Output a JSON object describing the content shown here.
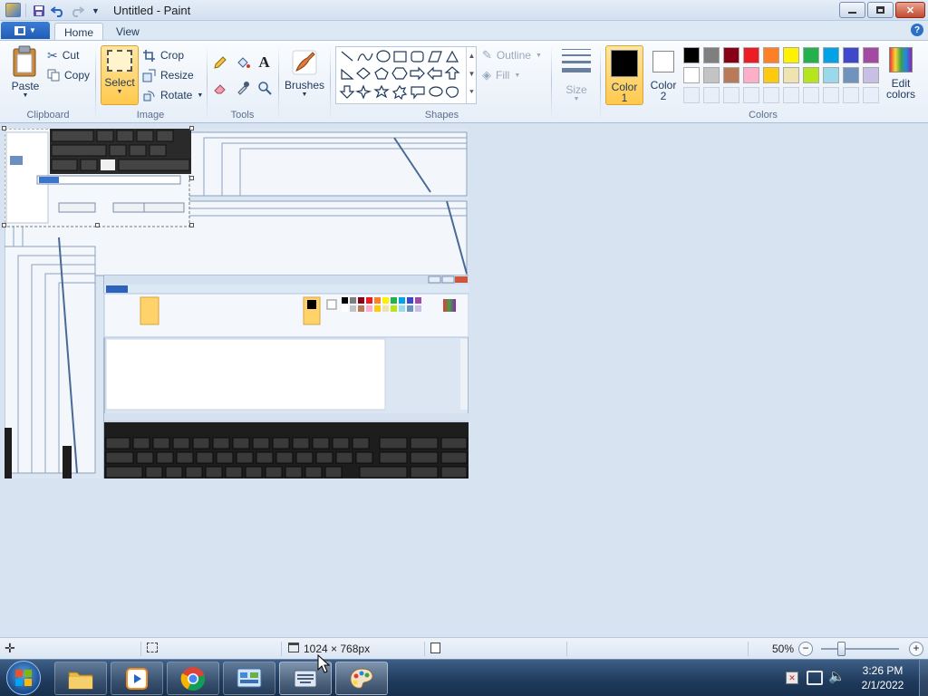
{
  "window": {
    "title": "Untitled - Paint"
  },
  "tabs": {
    "file_icon": "menu-icon",
    "home": "Home",
    "view": "View"
  },
  "clipboard": {
    "paste": "Paste",
    "cut": "Cut",
    "copy": "Copy",
    "group": "Clipboard"
  },
  "image": {
    "select": "Select",
    "crop": "Crop",
    "resize": "Resize",
    "rotate": "Rotate",
    "group": "Image"
  },
  "tools": {
    "group": "Tools",
    "brushes": "Brushes"
  },
  "shapes": {
    "outline": "Outline",
    "fill": "Fill",
    "group": "Shapes"
  },
  "size": {
    "label": "Size"
  },
  "colors": {
    "color1_line1": "Color",
    "color1_line2": "1",
    "color2_line1": "Color",
    "color2_line2": "2",
    "edit_line1": "Edit",
    "edit_line2": "colors",
    "group": "Colors",
    "color1_value": "#000000",
    "color2_value": "#ffffff",
    "palette_row1": [
      "#000000",
      "#7f7f7f",
      "#880015",
      "#ed1c24",
      "#ff7f27",
      "#fff200",
      "#22b14c",
      "#00a2e8",
      "#3f48cc",
      "#a349a4"
    ],
    "palette_row2": [
      "#ffffff",
      "#c3c3c3",
      "#b97a57",
      "#ffaec9",
      "#ffc90e",
      "#efe4b0",
      "#b5e61d",
      "#99d9ea",
      "#7092be",
      "#c8bfe7"
    ]
  },
  "status": {
    "dimensions": "1024 × 768px",
    "zoom": "50%",
    "zoom_level": 0.5
  },
  "taskbar": {
    "time": "3:26 PM",
    "date": "2/1/2022"
  }
}
